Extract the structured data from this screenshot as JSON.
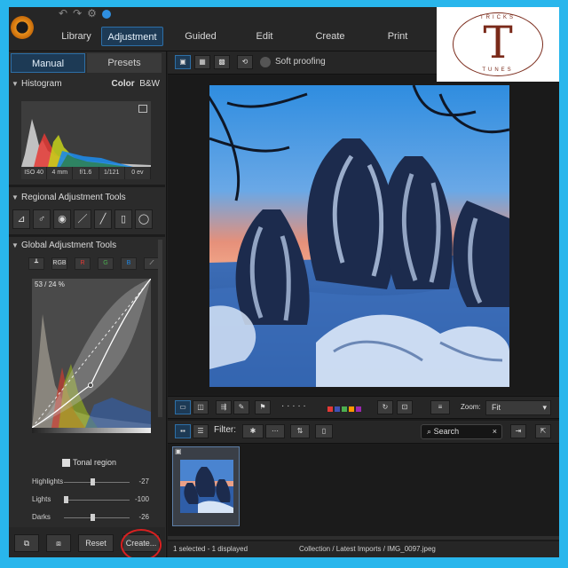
{
  "nav": {
    "tabs": [
      "Library",
      "Adjustment",
      "Guided",
      "Edit",
      "Create",
      "Print"
    ],
    "active": "Adjustment"
  },
  "watermark": {
    "top": "TRICKS",
    "letter": "T",
    "bottom": "TUNES"
  },
  "left_panel": {
    "subtabs": [
      "Manual",
      "Presets"
    ],
    "histogram": {
      "title": "Histogram",
      "color": "Color",
      "bw": "B&W"
    },
    "exif": [
      "ISO 40",
      "4 mm",
      "f/1.6",
      "1/121",
      "0 ev"
    ],
    "regional_title": "Regional Adjustment Tools",
    "global_title": "Global Adjustment Tools",
    "curve_tool_labels": [
      "RGB",
      "R",
      "G",
      "B"
    ],
    "curve_readout": "53 / 24 %",
    "tonal_region": "Tonal region",
    "adjustments": [
      {
        "label": "Highlights",
        "value": "-27",
        "level": 0.45
      },
      {
        "label": "Lights",
        "value": "-100",
        "level": 0.0
      },
      {
        "label": "Darks",
        "value": "-26",
        "level": 0.45
      }
    ],
    "bottom_buttons": {
      "reset": "Reset",
      "create": "Create..."
    }
  },
  "toolbar": {
    "soft_proofing": "Soft proofing"
  },
  "bottom_toolbar": {
    "dots": "· · · · ·",
    "zoom_label": "Zoom:",
    "zoom_value": "Fit",
    "filter_label": "Filter:",
    "search_placeholder": "Search",
    "label_colors": [
      "#e53935",
      "#3f51b5",
      "#4caf50",
      "#ff9800",
      "#9c27b0"
    ]
  },
  "status": {
    "selection": "1 selected - 1 displayed",
    "path": "Collection / Latest Imports / IMG_0097.jpeg"
  },
  "colors": {
    "accent": "#2d6fa7",
    "background": "#29b6ec",
    "highlight_ring": "#d82020"
  }
}
